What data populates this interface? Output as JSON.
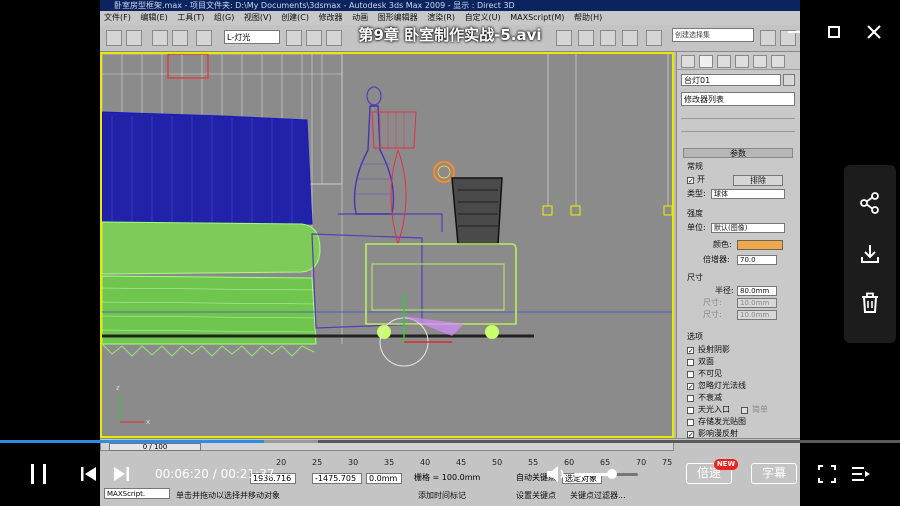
{
  "max": {
    "title_bar": "卧室房型框架.max    -  项目文件夹: D:\\My Documents\\3dsmax    -  Autodesk 3ds Max  2009    -  显示 : Direct 3D",
    "menu": [
      "文件(F)",
      "编辑(E)",
      "工具(T)",
      "组(G)",
      "视图(V)",
      "创建(C)",
      "修改器",
      "动画",
      "图形编辑器",
      "渲染(R)",
      "自定义(U)",
      "MAXScript(M)",
      "帮助(H)"
    ],
    "selection_filter": "L-灯光",
    "named_selection": "创建选择集",
    "panel": {
      "object_name": "台灯01",
      "modifier_list": "修改器列表",
      "params_header": "参数",
      "general": {
        "title": "常规",
        "on_label": "开",
        "exclude_button": "排除",
        "type_label": "类型:",
        "type_value": "球体"
      },
      "intensity": {
        "title": "强度",
        "unit_label": "单位:",
        "unit_value": "默认(图像)",
        "color_label": "颜色:",
        "color_hex": "#f0a848",
        "multiplier_label": "倍增器:",
        "multiplier_value": "70.0"
      },
      "size": {
        "title": "尺寸",
        "radius_label": "半径:",
        "radius_value": "80.0mm",
        "length_label": "尺寸:",
        "length_value": "10.0mm",
        "width_label": "尺寸:",
        "width_value": "10.0mm"
      },
      "options": {
        "title": "选项",
        "items": [
          {
            "label": "投射阴影",
            "checked": true
          },
          {
            "label": "双面",
            "checked": false
          },
          {
            "label": "不可见",
            "checked": false
          },
          {
            "label": "忽略灯光法线",
            "checked": true
          },
          {
            "label": "不衰减",
            "checked": false
          },
          {
            "label": "天光入口",
            "checked": false
          },
          {
            "label": "存储发光贴图",
            "checked": false
          },
          {
            "label": "影响漫反射",
            "checked": true
          },
          {
            "label": "影响镜面",
            "checked": true
          }
        ],
        "simple_label": "简单"
      }
    },
    "timeline": {
      "slider_label": "0 / 100",
      "ticks": [
        "20",
        "25",
        "30",
        "35",
        "40",
        "45",
        "50",
        "55",
        "60",
        "65",
        "70",
        "75"
      ]
    },
    "status": {
      "x_value": "1936.716",
      "y_value": "-1475.705",
      "z_value": "0.0mm",
      "grid": "栅格 = 100.0mm",
      "autokey": "自动关键点",
      "setkey": "设置关键点",
      "selected": "选定对象",
      "keyfilter": "关键点过滤器...",
      "prompt": "单击并拖动以选择并移动对象",
      "add_time_tag": "添加时间标记",
      "maxscript": "MAXScript."
    }
  },
  "player": {
    "video_title": "第9章  卧室制作实战-5.avi",
    "current_time": "00:06:20",
    "separator": " / ",
    "total_time": "00:21:37",
    "progress_fraction": 0.293,
    "buffered_fraction": 0.06,
    "volume_fraction": 0.6,
    "speed_label": "倍速",
    "new_badge": "NEW",
    "subtitle_label": "字幕"
  }
}
